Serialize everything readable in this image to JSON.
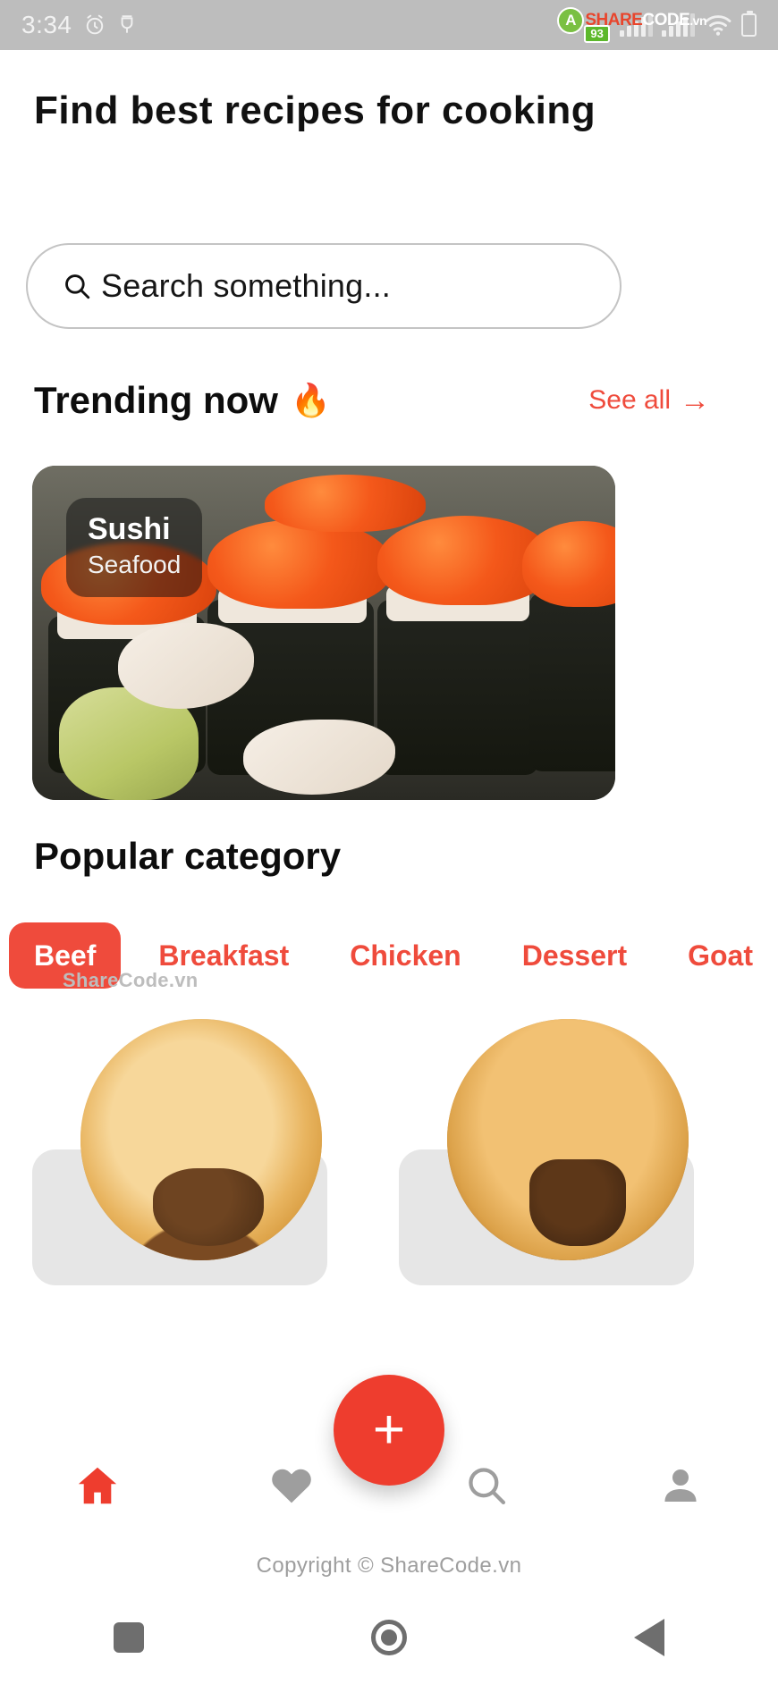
{
  "statusbar": {
    "time": "3:34",
    "alarm_icon": "alarm-clock-icon",
    "usb_icon": "usb-debug-icon",
    "signal_icon": "signal-bars-icon",
    "wifi_icon": "wifi-icon",
    "battery_icon": "battery-charging-icon",
    "battery_level": "93"
  },
  "watermark": {
    "logo_mark": "A",
    "logo_part1": "SHARE",
    "logo_part2": "CODE",
    "logo_part3": ".vn",
    "chips_mark": "ShareCode.vn",
    "footer": "Copyright © ShareCode.vn"
  },
  "header": {
    "title": "Find  best  recipes\nfor  cooking"
  },
  "search": {
    "placeholder": "Search something...",
    "icon": "search-icon"
  },
  "trending": {
    "title": "Trending now",
    "flame_icon": "🔥",
    "see_all_label": "See all",
    "see_all_arrow": "→",
    "card": {
      "title": "Sushi",
      "subtitle": "Seafood"
    }
  },
  "popular": {
    "title": "Popular category",
    "categories": [
      {
        "label": "Beef",
        "active": true
      },
      {
        "label": "Breakfast",
        "active": false
      },
      {
        "label": "Chicken",
        "active": false
      },
      {
        "label": "Dessert",
        "active": false
      },
      {
        "label": "Goat",
        "active": false
      }
    ]
  },
  "bottom_nav": {
    "items": [
      {
        "name": "home-icon",
        "active": true
      },
      {
        "name": "heart-icon",
        "active": false
      },
      {
        "name": "search-icon",
        "active": false
      },
      {
        "name": "person-icon",
        "active": false
      }
    ],
    "fab_label": "+"
  },
  "colors": {
    "accent": "#ef4b3c",
    "fab": "#ee3d2e",
    "inactive": "#9e9e9e",
    "statusbar": "#bdbdbd"
  }
}
